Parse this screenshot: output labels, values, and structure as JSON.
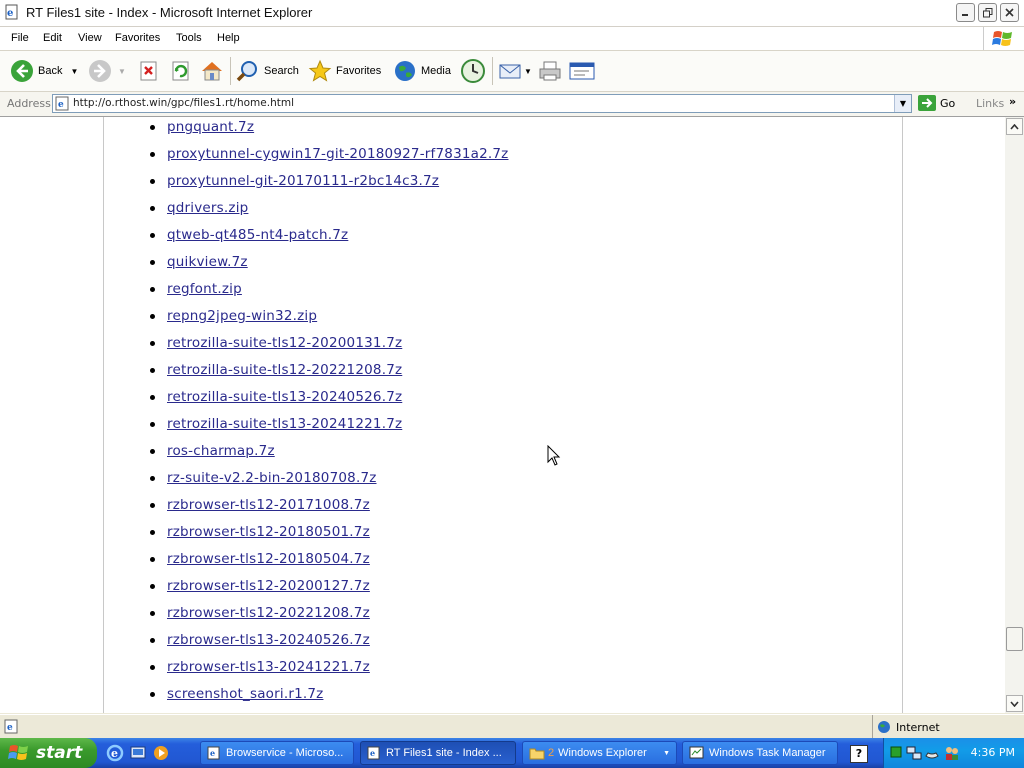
{
  "window": {
    "title": "RT Files1 site - Index - Microsoft Internet Explorer"
  },
  "menu": [
    "File",
    "Edit",
    "View",
    "Favorites",
    "Tools",
    "Help"
  ],
  "toolbar": {
    "back": "Back",
    "search": "Search",
    "favorites": "Favorites",
    "media": "Media"
  },
  "address": {
    "label": "Address",
    "url": "http://o.rthost.win/gpc/files1.rt/home.html",
    "go": "Go",
    "links": "Links"
  },
  "files": [
    "pngquant.7z",
    "proxytunnel-cygwin17-git-20180927-rf7831a2.7z",
    "proxytunnel-git-20170111-r2bc14c3.7z",
    "qdrivers.zip",
    "qtweb-qt485-nt4-patch.7z",
    "quikview.7z",
    "regfont.zip",
    "repng2jpeg-win32.zip",
    "retrozilla-suite-tls12-20200131.7z",
    "retrozilla-suite-tls12-20221208.7z",
    "retrozilla-suite-tls13-20240526.7z",
    "retrozilla-suite-tls13-20241221.7z",
    "ros-charmap.7z",
    "rz-suite-v2.2-bin-20180708.7z",
    "rzbrowser-tls12-20171008.7z",
    "rzbrowser-tls12-20180501.7z",
    "rzbrowser-tls12-20180504.7z",
    "rzbrowser-tls12-20200127.7z",
    "rzbrowser-tls12-20221208.7z",
    "rzbrowser-tls13-20240526.7z",
    "rzbrowser-tls13-20241221.7z",
    "screenshot_saori.r1.7z"
  ],
  "status": {
    "zone": "Internet"
  },
  "taskbar": {
    "start": "start",
    "tasks": [
      {
        "label": "Browservice - Microso...",
        "active": false
      },
      {
        "label": "RT Files1 site - Index ...",
        "active": true
      },
      {
        "count": "2",
        "label": "Windows Explorer",
        "active": false
      },
      {
        "label": "Windows Task Manager",
        "active": false
      }
    ],
    "clock": "4:36 PM"
  },
  "colors": {
    "link": "#2a2a8c",
    "taskbar": "#245edb",
    "start": "#3a9a2c"
  }
}
